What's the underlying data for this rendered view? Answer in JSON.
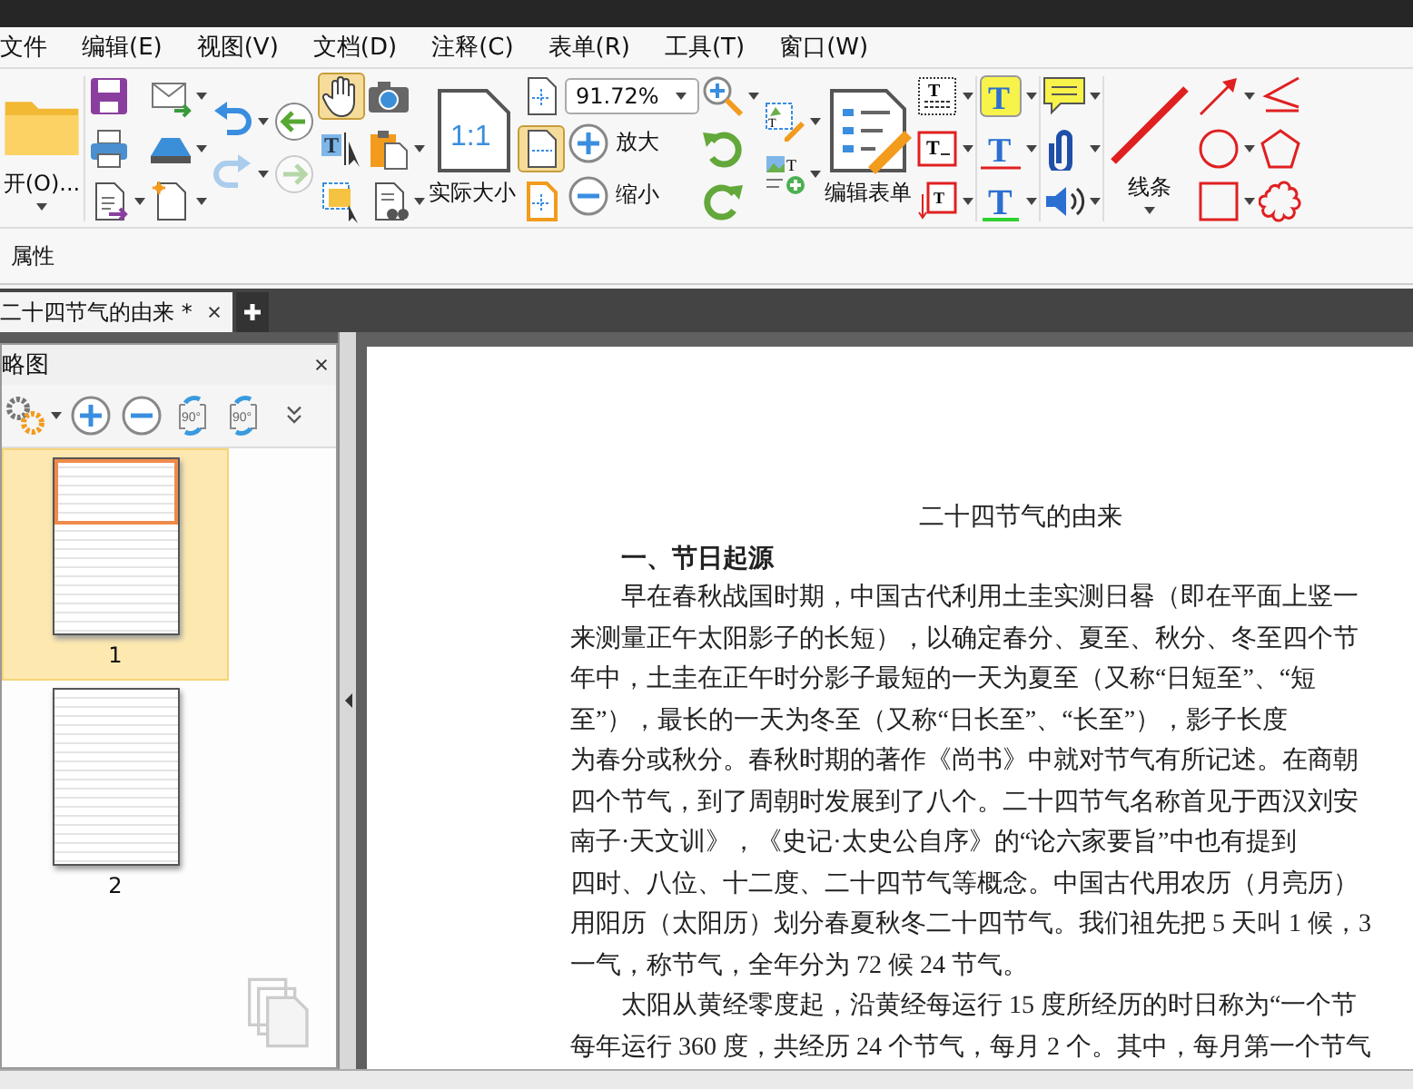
{
  "menu": [
    {
      "label": "文件"
    },
    {
      "label": "编辑(E)"
    },
    {
      "label": "视图(V)"
    },
    {
      "label": "文档(D)"
    },
    {
      "label": "注释(C)"
    },
    {
      "label": "表单(R)"
    },
    {
      "label": "工具(T)"
    },
    {
      "label": "窗口(W)"
    }
  ],
  "toolbar": [
    {
      "kind": "large",
      "items": [
        {
          "kind": "folder",
          "label": "开(O)...",
          "selected": false,
          "dropdown": true
        }
      ]
    },
    {
      "kind": "column",
      "items": [
        {
          "kind": "save",
          "selected": false,
          "dropdown": false,
          "disabled": false
        },
        {
          "kind": "print",
          "selected": false,
          "dropdown": false,
          "disabled": false
        },
        {
          "kind": "export",
          "selected": false,
          "dropdown": true,
          "disabled": false
        }
      ]
    },
    {
      "kind": "column",
      "items": [
        {
          "kind": "mail",
          "selected": false,
          "dropdown": true,
          "disabled": false
        },
        {
          "kind": "scanner",
          "selected": false,
          "dropdown": true,
          "disabled": false
        },
        {
          "kind": "newdoc",
          "selected": false,
          "dropdown": true,
          "disabled": false
        }
      ]
    },
    {
      "kind": "column",
      "items": [
        {
          "kind": "undo",
          "selected": false,
          "dropdown": true,
          "disabled": false
        },
        {
          "kind": "redo",
          "selected": false,
          "dropdown": true,
          "disabled": true
        }
      ]
    },
    {
      "kind": "column",
      "items": [
        {
          "kind": "back",
          "selected": false,
          "dropdown": false,
          "disabled": false
        },
        {
          "kind": "forward",
          "selected": false,
          "dropdown": false,
          "disabled": true
        }
      ]
    },
    {
      "kind": "column",
      "items": [
        {
          "kind": "hand",
          "selected": true,
          "dropdown": false,
          "disabled": false
        },
        {
          "kind": "textselect",
          "glyph": "T",
          "selected": false,
          "dropdown": false,
          "disabled": false
        },
        {
          "kind": "notes",
          "selected": false,
          "dropdown": false,
          "disabled": false
        }
      ]
    },
    {
      "kind": "column",
      "items": [
        {
          "kind": "camera",
          "selected": false,
          "dropdown": false,
          "disabled": false
        },
        {
          "kind": "clipboard",
          "selected": false,
          "dropdown": true,
          "disabled": false
        },
        {
          "kind": "docsearch",
          "selected": false,
          "dropdown": true,
          "disabled": false
        }
      ]
    },
    {
      "kind": "large",
      "items": [
        {
          "kind": "actual",
          "glyph": "1:1",
          "label": "实际大小",
          "selected": false,
          "dropdown": false
        }
      ]
    },
    {
      "kind": "column",
      "items": [
        {
          "kind": "fitpage",
          "selected": false,
          "dropdown": false,
          "disabled": false
        },
        {
          "kind": "fitwidth",
          "selected": true,
          "dropdown": false,
          "disabled": false
        },
        {
          "kind": "fitvisible",
          "selected": false,
          "dropdown": false,
          "disabled": false
        }
      ]
    },
    {
      "kind": "zoom",
      "value": "91.72%",
      "items": [
        {
          "kind": "zoomin",
          "label": "放大"
        },
        {
          "kind": "zoomout",
          "label": "缩小"
        }
      ]
    },
    {
      "kind": "column",
      "items": [
        {
          "kind": "magnifier",
          "selected": false,
          "dropdown": true,
          "disabled": false
        },
        {
          "kind": "rotateleft",
          "selected": false,
          "dropdown": false,
          "disabled": false
        },
        {
          "kind": "rotateright",
          "selected": false,
          "dropdown": false,
          "disabled": false
        }
      ]
    },
    {
      "kind": "column",
      "items": [
        {
          "kind": "imageedit",
          "glyph": "T",
          "selected": false,
          "dropdown": true,
          "disabled": false
        },
        {
          "kind": "imageadd",
          "glyph": "T",
          "selected": false,
          "dropdown": true,
          "disabled": false
        }
      ]
    },
    {
      "kind": "large",
      "items": [
        {
          "kind": "form",
          "label": "编辑表单",
          "selected": false,
          "dropdown": false
        }
      ]
    },
    {
      "kind": "column",
      "items": [
        {
          "kind": "textgrid",
          "glyph": "T",
          "selected": false,
          "dropdown": true,
          "disabled": false
        },
        {
          "kind": "textbox",
          "glyph": "T",
          "selected": false,
          "dropdown": true,
          "disabled": false
        },
        {
          "kind": "callout",
          "glyph": "T",
          "selected": false,
          "dropdown": true,
          "disabled": false
        }
      ]
    },
    {
      "kind": "column",
      "items": [
        {
          "kind": "highlight",
          "glyph": "T",
          "selected": false,
          "dropdown": true,
          "disabled": false
        },
        {
          "kind": "strike",
          "glyph": "T",
          "selected": false,
          "dropdown": true,
          "disabled": false
        },
        {
          "kind": "underline",
          "glyph": "T",
          "selected": false,
          "dropdown": true,
          "disabled": false
        }
      ]
    },
    {
      "kind": "column",
      "items": [
        {
          "kind": "note",
          "selected": false,
          "dropdown": true,
          "disabled": false
        },
        {
          "kind": "clip",
          "selected": false,
          "dropdown": true,
          "disabled": false
        },
        {
          "kind": "sound",
          "selected": false,
          "dropdown": true,
          "disabled": false
        }
      ]
    },
    {
      "kind": "large",
      "items": [
        {
          "kind": "line",
          "label": "线条",
          "selected": false,
          "dropdown": true
        }
      ]
    },
    {
      "kind": "column",
      "items": [
        {
          "kind": "arrow",
          "selected": false,
          "dropdown": true,
          "disabled": false
        },
        {
          "kind": "circle",
          "selected": false,
          "dropdown": true,
          "disabled": false
        },
        {
          "kind": "square",
          "selected": false,
          "dropdown": true,
          "disabled": false
        }
      ]
    },
    {
      "kind": "column",
      "items": [
        {
          "kind": "polyline",
          "selected": false,
          "dropdown": false,
          "disabled": false
        },
        {
          "kind": "pentagon",
          "selected": false,
          "dropdown": false,
          "disabled": false
        },
        {
          "kind": "cloud",
          "selected": false,
          "dropdown": false,
          "disabled": false
        }
      ]
    }
  ],
  "properties_bar": {
    "label": "属性"
  },
  "tabs": [
    {
      "label": "二十四节气的由来 *",
      "selected": true
    }
  ],
  "thumbnail_panel": {
    "title": "略图",
    "tools": [
      {
        "kind": "settings",
        "dropdown": true
      },
      {
        "kind": "zoomin",
        "dropdown": false
      },
      {
        "kind": "zoomout",
        "dropdown": false
      },
      {
        "kind": "rotateleft",
        "glyph": "90°",
        "dropdown": false
      },
      {
        "kind": "rotateright",
        "glyph": "90°",
        "dropdown": false
      },
      {
        "kind": "more",
        "dropdown": false
      }
    ],
    "pages": [
      {
        "label": "1",
        "selected": true
      },
      {
        "label": "2",
        "selected": false
      }
    ]
  },
  "document": {
    "title": "二十四节气的由来",
    "heading": "一、节日起源",
    "paragraphs": [
      [
        "早在春秋战国时期，中国古代利用土圭实测日晷（即在平面上竖一",
        "来测量正午太阳影子的长短），以确定春分、夏至、秋分、冬至四个节",
        "年中，土圭在正午时分影子最短的一天为夏至（又称“日短至”、“短",
        "至”），最长的一天为冬至（又称“日长至”、“长至”），影子长度",
        "为春分或秋分。春秋时期的著作《尚书》中就对节气有所记述。在商朝",
        "四个节气，到了周朝时发展到了八个。二十四节气名称首见于西汉刘安",
        "南子·天文训》，《史记·太史公自序》的“论六家要旨”中也有提到",
        "四时、八位、十二度、二十四节气等概念。中国古代用农历（月亮历）",
        "用阳历（太阳历）划分春夏秋冬二十四节气。我们祖先把 5 天叫 1 候，3",
        "一气，称节气，全年分为 72 候 24 节气。"
      ],
      [
        "太阳从黄经零度起，沿黄经每运行 15 度所经历的时日称为“一个节",
        "每年运行 360 度，共经历 24 个节气，每月 2 个。其中，每月第一个节气"
      ]
    ]
  }
}
